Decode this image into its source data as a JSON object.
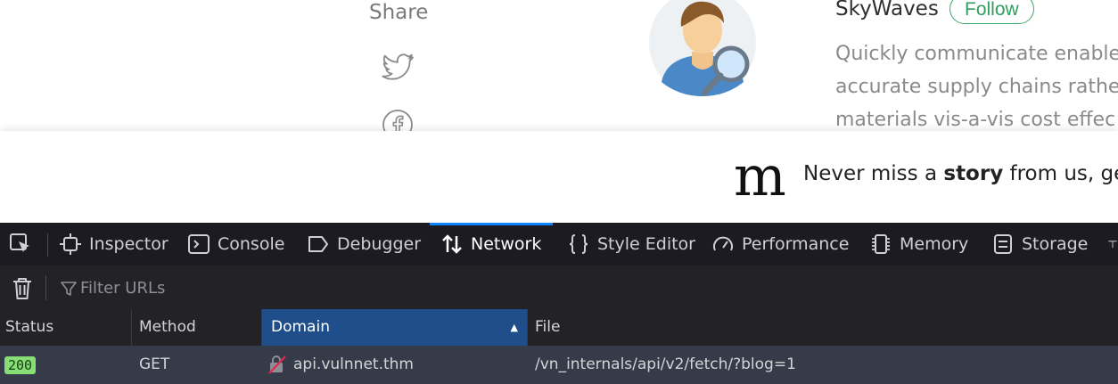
{
  "page": {
    "share_label": "Share",
    "author_name": "SkyWaves",
    "follow_label": "Follow",
    "bio_lines": [
      "Quickly communicate enable",
      "accurate supply chains rathe",
      "materials vis-a-vis cost effec"
    ]
  },
  "banner": {
    "logo": "m",
    "text_before": "Never miss a ",
    "text_bold": "story",
    "text_after": " from us, ge"
  },
  "devtools": {
    "tabs": [
      {
        "label": "Inspector",
        "icon": "inspector-icon"
      },
      {
        "label": "Console",
        "icon": "console-icon"
      },
      {
        "label": "Debugger",
        "icon": "debugger-icon"
      },
      {
        "label": "Network",
        "icon": "network-icon",
        "active": true
      },
      {
        "label": "Style Editor",
        "icon": "braces-icon"
      },
      {
        "label": "Performance",
        "icon": "gauge-icon"
      },
      {
        "label": "Memory",
        "icon": "memory-chip-icon"
      },
      {
        "label": "Storage",
        "icon": "storage-icon"
      }
    ],
    "filter_placeholder": "Filter URLs",
    "columns": {
      "status": "Status",
      "method": "Method",
      "domain": "Domain",
      "file": "File"
    },
    "rows": [
      {
        "status": "200",
        "method": "GET",
        "domain": "api.vulnnet.thm",
        "file": "/vn_internals/api/v2/fetch/?blog=1"
      }
    ]
  },
  "colors": {
    "follow_green": "#3aa86b",
    "devtools_bg": "#232327",
    "active_tab_indicator": "#0a84ff",
    "domain_header_bg": "#204e8a",
    "status_ok": "#86de74",
    "selected_row_bg": "#353b48"
  }
}
